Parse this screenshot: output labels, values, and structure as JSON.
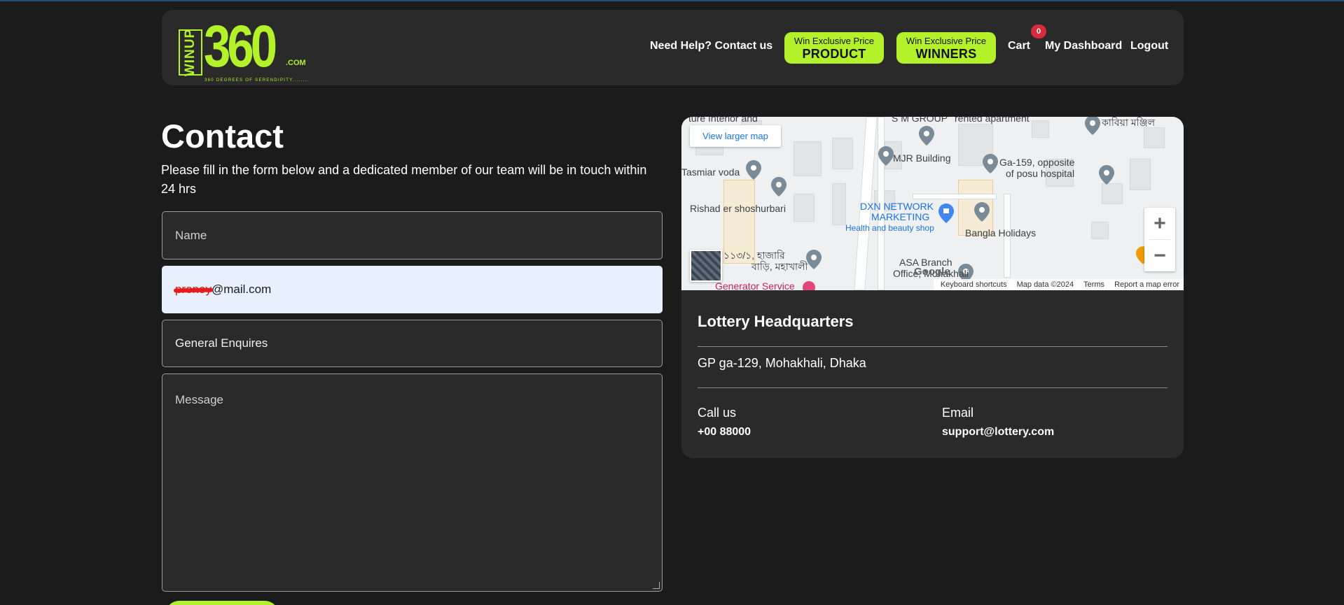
{
  "header": {
    "logo": {
      "brand_side": "WINUP",
      "brand_number": "360",
      "brand_suffix": ".COM",
      "tagline": "360 DEGREES OF SERENDIPITY........"
    },
    "help_link": "Need Help? Contact us",
    "product_button": {
      "small": "Win Exclusive Price",
      "big": "PRODUCT"
    },
    "winners_button": {
      "small": "Win Exclusive Price",
      "big": "WINNERS"
    },
    "cart_label": "Cart",
    "cart_count": "0",
    "dashboard_link": "My Dashboard",
    "logout_link": "Logout"
  },
  "contact": {
    "title": "Contact",
    "description": "Please fill in the form below and a dedicated member of our team will be in touch within 24 hrs",
    "name_placeholder": "Name",
    "email_redacted": "pronoy",
    "email_domain": "@mail.com",
    "subject_value": "General Enquires",
    "message_placeholder": "Message"
  },
  "map": {
    "view_larger": "View larger map",
    "zoom_in": "+",
    "zoom_out": "−",
    "labels": {
      "l1": "S M GROUP",
      "l2": "MJR Building",
      "l3": "Ga-159, opposite",
      "l3b": "of posu hospital",
      "l4": "Tasmiar voda",
      "l5": "Rishad er shoshurbari",
      "l6": "DXN NETWORK",
      "l6b": "MARKETING",
      "l7": "Health and beauty shop",
      "l8": "Bangla Holidays",
      "l9": "ASA Branch",
      "l9b": "Office, Mohakhali",
      "l10": "Generator Service",
      "l11": "১১৩/১, হাজারি",
      "l11b": "বাড়ি, মহাখালী",
      "l12": "কাবিয়া মঞ্জিল",
      "l13": "ture Interior and",
      "l14": "rented apartment"
    },
    "google": "Google",
    "footer": [
      "Keyboard shortcuts",
      "Map data ©2024",
      "Terms",
      "Report a map error"
    ]
  },
  "info": {
    "title": "Lottery Headquarters",
    "address": "GP ga-129, Mohakhali, Dhaka",
    "call_label": "Call us",
    "call_value": "+00 88000",
    "email_label": "Email",
    "email_value": "support@lottery.com"
  },
  "colors": {
    "accent": "#b3f12a",
    "background": "#1b1b1b",
    "card": "#2a2a2a",
    "badge": "#d62b3a"
  }
}
